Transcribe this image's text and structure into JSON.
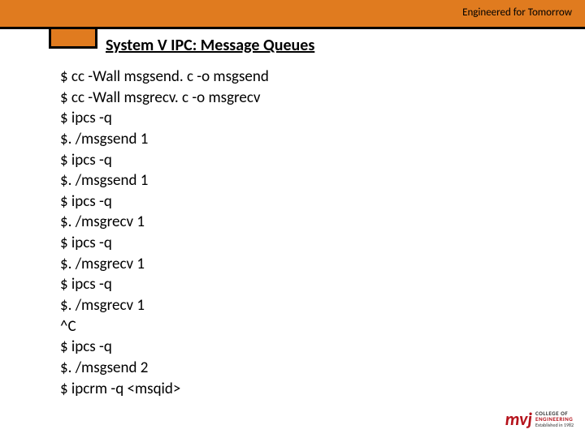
{
  "header": {
    "tagline": "Engineered for Tomorrow"
  },
  "title": "System V IPC: Message Queues",
  "lines": [
    "$ cc -Wall msgsend. c -o msgsend",
    "$ cc -Wall msgrecv. c -o msgrecv",
    "$ ipcs -q",
    "$. /msgsend 1",
    "$ ipcs -q",
    "$. /msgsend 1",
    "$ ipcs -q",
    "$. /msgrecv 1",
    "$ ipcs -q",
    "$. /msgrecv 1",
    "$ ipcs -q",
    "$. /msgrecv 1",
    "^C",
    "$ ipcs -q",
    "$. /msgsend 2",
    "$ ipcrm -q <msqid>"
  ],
  "logo": {
    "mark": "mvj",
    "l1": "COLLEGE OF",
    "l2": "ENGINEERING",
    "l3": "Established in 1982"
  }
}
